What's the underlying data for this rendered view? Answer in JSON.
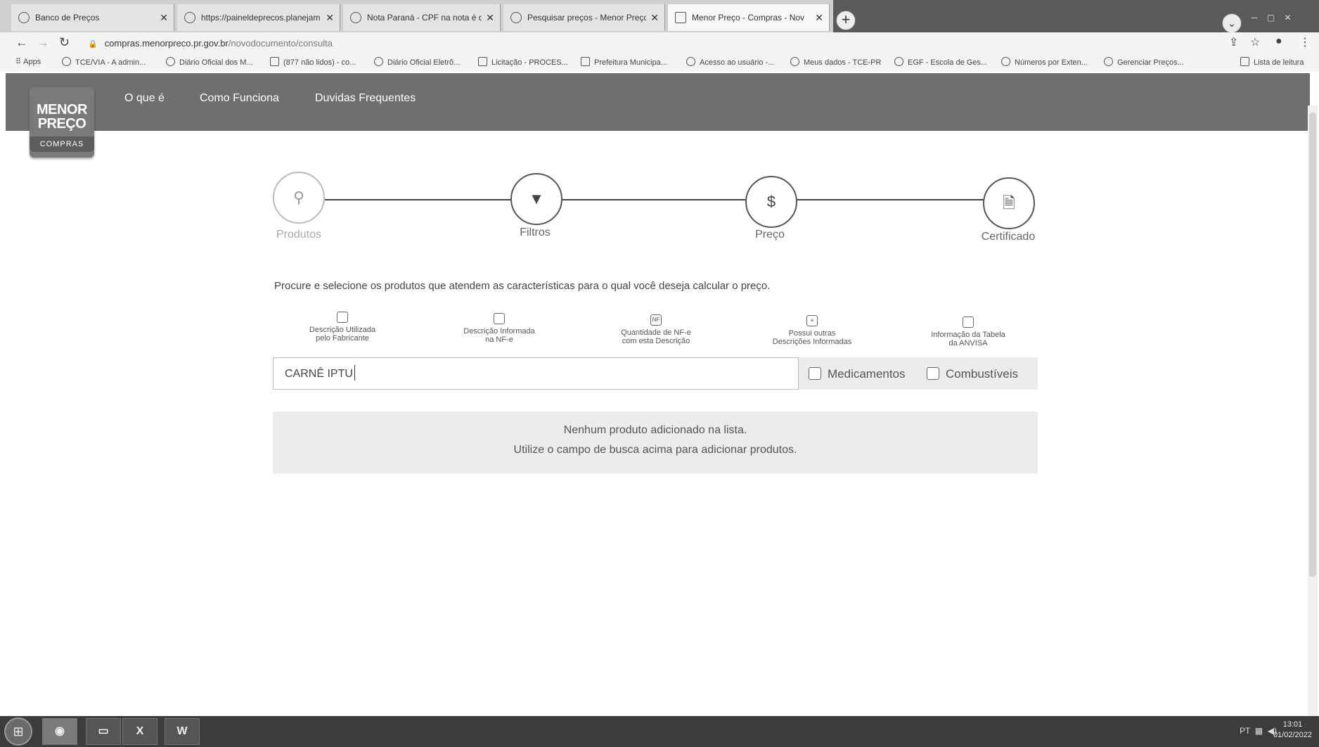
{
  "browser": {
    "tabs": [
      {
        "title": "Banco de Preços"
      },
      {
        "title": "https://paineldeprecos.planejam"
      },
      {
        "title": "Nota Paraná - CPF na nota é di"
      },
      {
        "title": "Pesquisar preços - Menor Preço"
      },
      {
        "title": "Menor Preço - Compras - Nov"
      }
    ],
    "active_tab": 4,
    "url_host": "compras.menorpreco.pr.gov.br",
    "url_path": "/novodocumento/consulta",
    "bookmarks": [
      {
        "label": "Apps"
      },
      {
        "label": "TCE/VIA - A admin..."
      },
      {
        "label": "Diário Oficial dos M..."
      },
      {
        "label": "(877 não lidos) - co..."
      },
      {
        "label": "Diário Oficial Eletrô..."
      },
      {
        "label": "Licitação - PROCES..."
      },
      {
        "label": "Prefeitura Municipa..."
      },
      {
        "label": "Acesso ao usuário -..."
      },
      {
        "label": "Meus dados - TCE-PR"
      },
      {
        "label": "EGF - Escola de Ges..."
      },
      {
        "label": "Números por Exten..."
      },
      {
        "label": "Gerenciar Preços..."
      }
    ],
    "reading_list": "Lista de leitura"
  },
  "site": {
    "logo_line1": "MENOR",
    "logo_line2": "PREÇO",
    "logo_line3": "COMPRAS",
    "menu": [
      "O que é",
      "Como Funciona",
      "Duvidas Frequentes"
    ]
  },
  "stepper": {
    "steps": [
      {
        "label": "Produtos",
        "icon": "search-icon"
      },
      {
        "label": "Filtros",
        "icon": "filter-icon"
      },
      {
        "label": "Preço",
        "icon": "dollar-icon"
      },
      {
        "label": "Certificado",
        "icon": "document-icon"
      }
    ],
    "current": 0
  },
  "instruction": "Procure e selecione os produtos que atendem as características para o qual você deseja calcular o preço.",
  "legend": [
    {
      "line1": "Descrição Utilizada",
      "line2": "pelo Fabricante"
    },
    {
      "line1": "Descrição Informada",
      "line2": "na NF-e"
    },
    {
      "line1": "Quantidade de NF-e",
      "line2": "com esta Descrição"
    },
    {
      "line1": "Possui outras",
      "line2": "Descrições Informadas"
    },
    {
      "line1": "Informação da Tabela",
      "line2": "da ANVISA"
    }
  ],
  "search": {
    "value": "CARNÊ IPTU"
  },
  "filters": {
    "medicamentos": "Medicamentos",
    "combustiveis": "Combustíveis"
  },
  "empty_state": {
    "line1": "Nenhum produto adicionado na lista.",
    "line2": "Utilize o campo de busca acima para adicionar produtos."
  },
  "taskbar": {
    "apps": [
      "",
      "",
      "X",
      "W"
    ],
    "tray": "PT",
    "time": "13:01",
    "date": "01/02/2022"
  }
}
